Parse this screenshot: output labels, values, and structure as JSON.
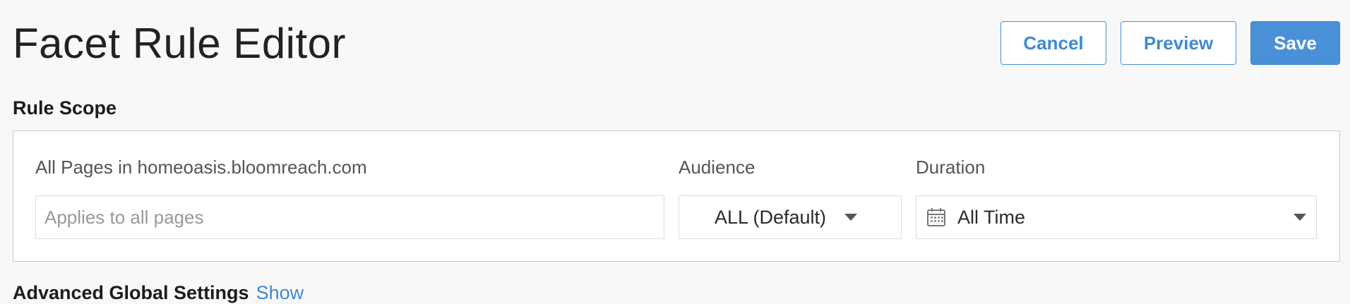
{
  "header": {
    "title": "Facet Rule Editor",
    "cancel_label": "Cancel",
    "preview_label": "Preview",
    "save_label": "Save"
  },
  "colors": {
    "accent": "#4a90d9",
    "background": "#f8f8f8",
    "border": "#c8c8c8"
  },
  "rule_scope": {
    "title": "Rule Scope",
    "pages_label": "All Pages in homeoasis.bloomreach.com",
    "pages_input": {
      "value": "",
      "placeholder": "Applies to all pages"
    },
    "audience_label": "Audience",
    "audience_value": "ALL (Default)",
    "duration_label": "Duration",
    "duration_value": "All Time",
    "duration_icon": "calendar-icon"
  },
  "advanced": {
    "title": "Advanced Global Settings",
    "toggle_label": "Show"
  }
}
